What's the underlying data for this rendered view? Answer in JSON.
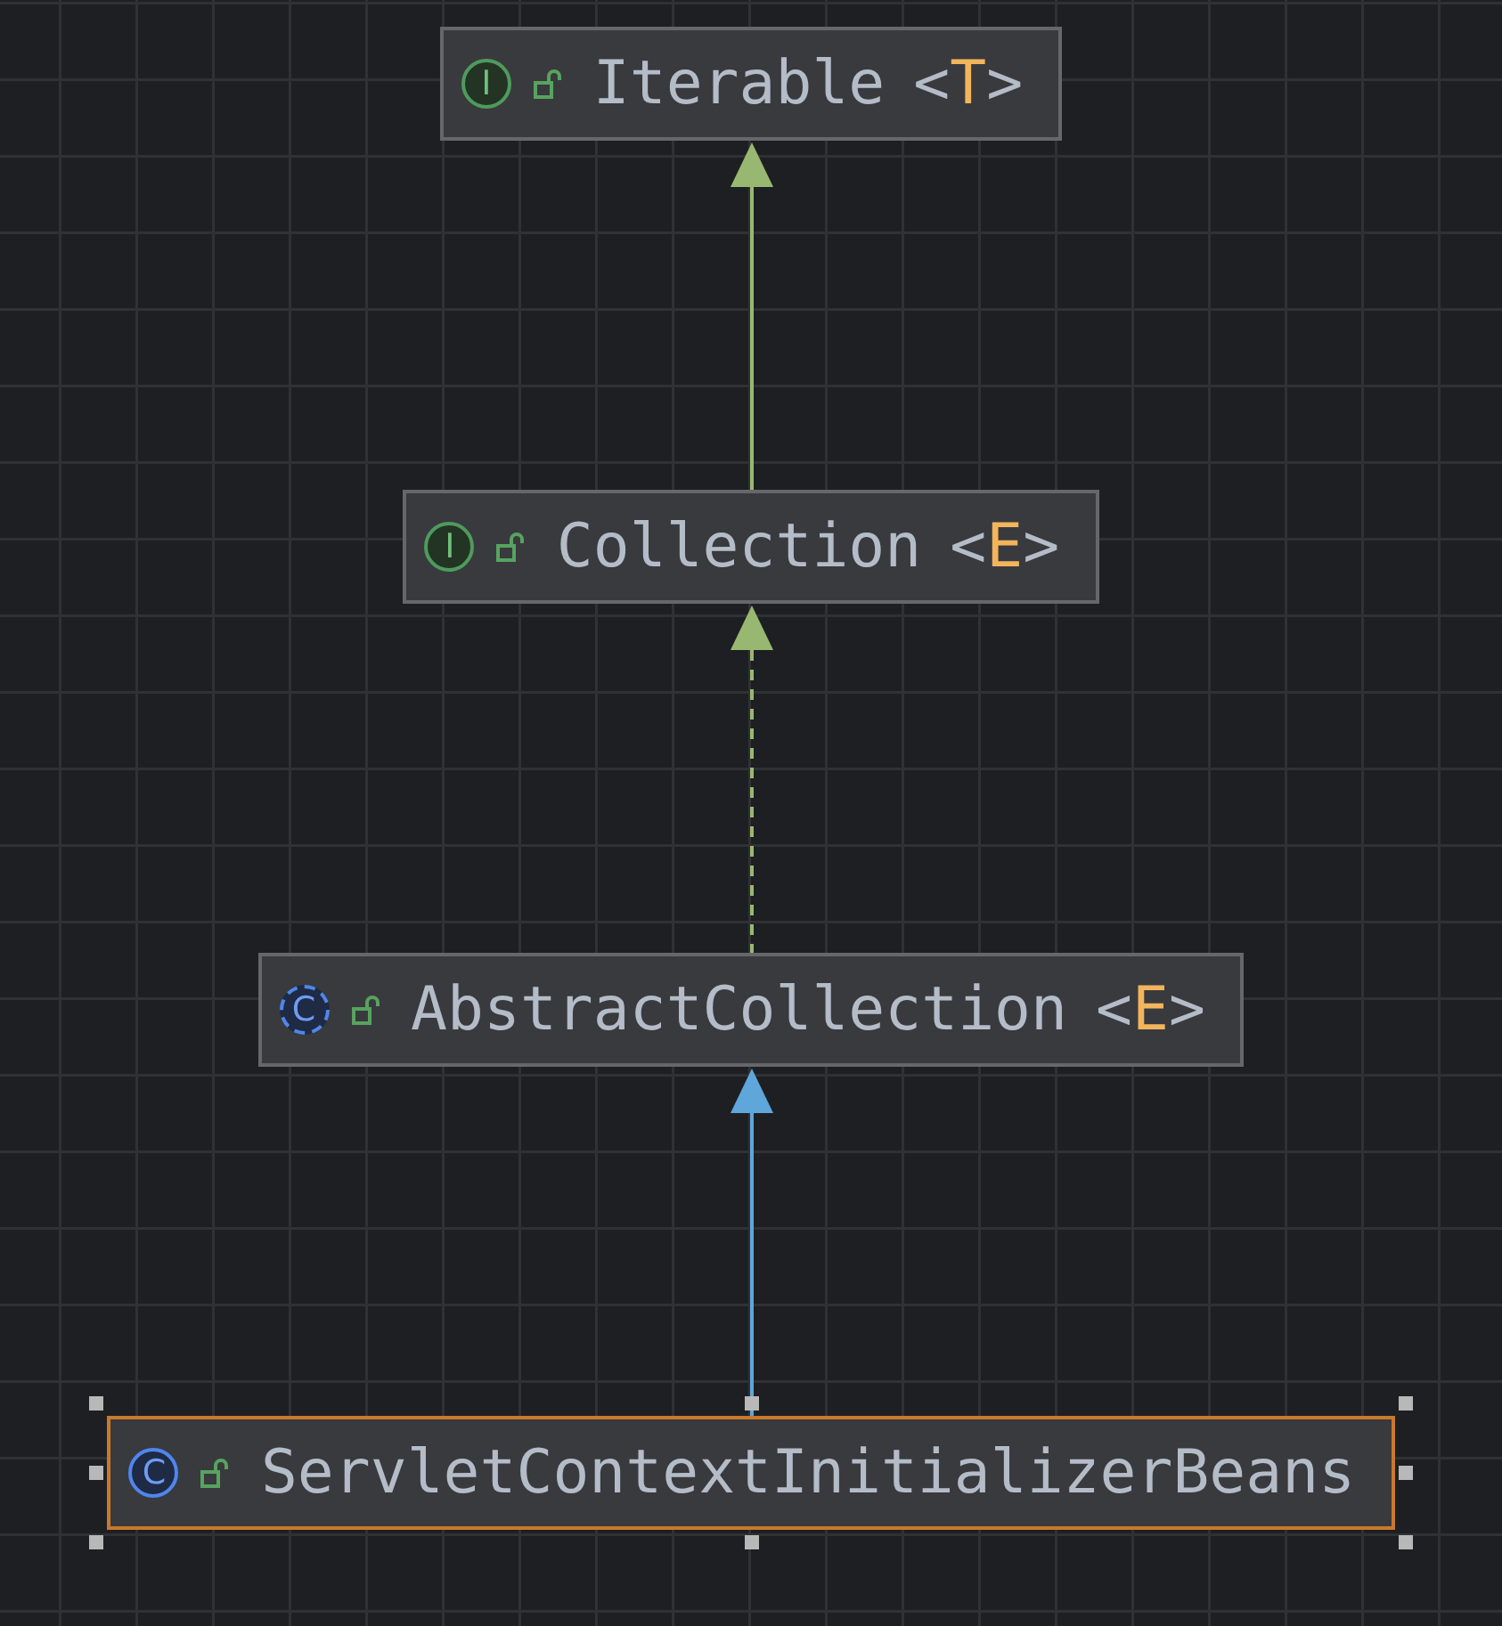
{
  "diagram": {
    "nodes": [
      {
        "kind": "interface",
        "badge": "I",
        "name": "Iterable",
        "type_open": "<",
        "type_param": "T",
        "type_close": ">",
        "selected": false
      },
      {
        "kind": "interface",
        "badge": "I",
        "name": "Collection",
        "type_open": "<",
        "type_param": "E",
        "type_close": ">",
        "selected": false
      },
      {
        "kind": "abstract_class",
        "badge": "C",
        "name": "AbstractCollection",
        "type_open": "<",
        "type_param": "E",
        "type_close": ">",
        "selected": false
      },
      {
        "kind": "class",
        "badge": "C",
        "name": "ServletContextInitializerBeans",
        "selected": true
      }
    ],
    "edges": [
      {
        "kind": "extends"
      },
      {
        "kind": "implements"
      },
      {
        "kind": "extends_class"
      }
    ]
  }
}
